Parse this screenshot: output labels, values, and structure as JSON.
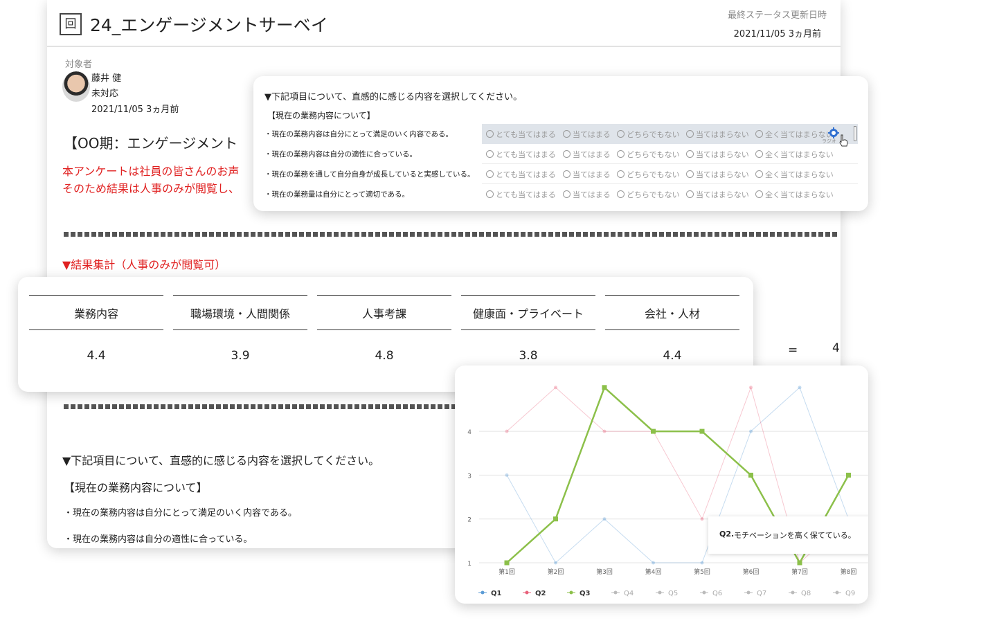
{
  "doc": {
    "icon_glyph": "回",
    "title": "24_エンゲージメントサーベイ",
    "status_label": "最終ステータス更新日時",
    "status_value": "2021/11/05 3ヵ月前",
    "target_label": "対象者",
    "person_name": "藤井 健",
    "person_status": "未対応",
    "person_date": "2021/11/05 3ヵ月前",
    "period_title": "【OO期：エンゲージメント",
    "red_line_1": "本アンケートは社員の皆さんのお声",
    "red_line_2": "そのため結果は人事のみが閲覧し、",
    "result_heading": "▼結果集計（人事のみが閲覧可）",
    "equals_sign": "=",
    "equals_value": "4",
    "instruction": "▼下記項目について、直感的に感じる内容を選択してください。",
    "section": "【現在の業務内容について】",
    "question_a": "・現在の業務内容は自分にとって満足のいく内容である。",
    "question_b": "・現在の業務内容は自分の適性に合っている。"
  },
  "survey": {
    "instruction": "▼下記項目について、直感的に感じる内容を選択してください。",
    "section": "【現在の業務内容について】",
    "options": [
      "とても当てはまる",
      "当てはまる",
      "どちらでもない",
      "当てはまらない",
      "全く当てはまらない"
    ],
    "questions": [
      "・現在の業務内容は自分にとって満足のいく内容である。",
      "・現在の業務内容は自分の適性に合っている。",
      "・現在の業務を通して自分自身が成長していると実感している。",
      "・現在の業務量は自分にとって適切である。"
    ],
    "radio_tag": "ラジオ"
  },
  "scores": {
    "categories": [
      "業務内容",
      "職場環境・人間関係",
      "人事考課",
      "健康面・プライベート",
      "会社・人材"
    ],
    "values": [
      "4.4",
      "3.9",
      "4.8",
      "3.8",
      "4.4"
    ]
  },
  "chart_data": {
    "type": "line",
    "categories": [
      "第1回",
      "第2回",
      "第3回",
      "第4回",
      "第5回",
      "第6回",
      "第7回",
      "第8回"
    ],
    "y_ticks": [
      1,
      2,
      3,
      4
    ],
    "series": [
      {
        "name": "Q1",
        "color": "#5b9bd5",
        "values": [
          3,
          1,
          2,
          1,
          1,
          4,
          5,
          2
        ],
        "highlight": false
      },
      {
        "name": "Q2",
        "color": "#e8607a",
        "values": [
          4,
          5,
          4,
          4,
          2,
          5,
          1,
          2
        ],
        "highlight": false
      },
      {
        "name": "Q3",
        "color": "#8cc04a",
        "values": [
          1,
          2,
          5,
          4,
          4,
          3,
          1,
          3
        ],
        "highlight": true
      },
      {
        "name": "Q4",
        "color": "#bbbbbb",
        "values": [],
        "highlight": false
      },
      {
        "name": "Q5",
        "color": "#bbbbbb",
        "values": [],
        "highlight": false
      },
      {
        "name": "Q6",
        "color": "#bbbbbb",
        "values": [],
        "highlight": false
      },
      {
        "name": "Q7",
        "color": "#bbbbbb",
        "values": [],
        "highlight": false
      },
      {
        "name": "Q8",
        "color": "#bbbbbb",
        "values": [],
        "highlight": false
      },
      {
        "name": "Q9",
        "color": "#bbbbbb",
        "values": [],
        "highlight": false
      }
    ],
    "tooltip_key": "Q2.",
    "tooltip_text": "モチベーションを高く保てている。"
  }
}
